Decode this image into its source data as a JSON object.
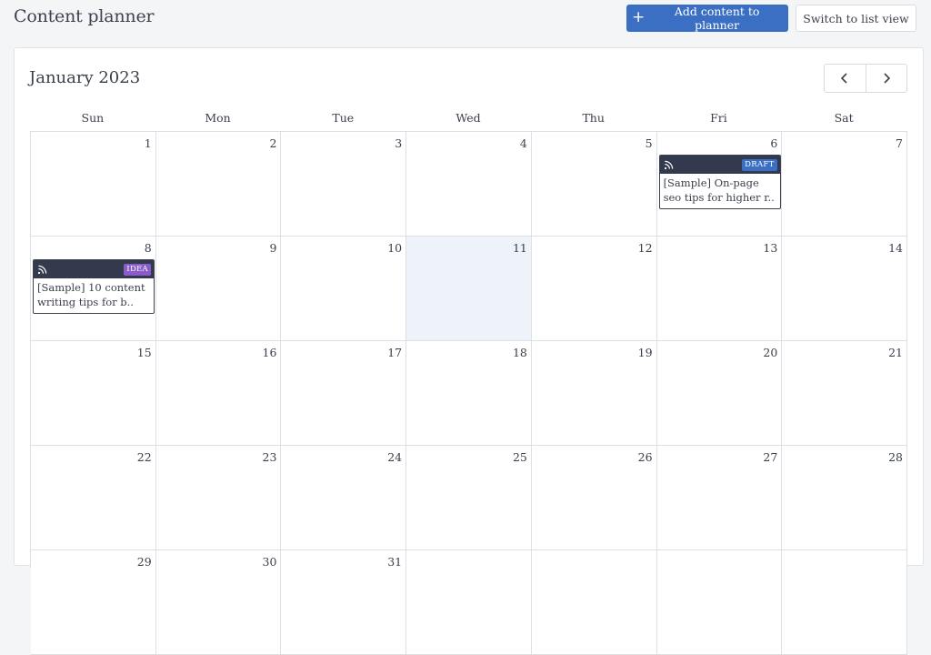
{
  "header": {
    "title": "Content planner",
    "add_label": "Add content to planner",
    "switch_label": "Switch to list view"
  },
  "calendar": {
    "month_label": "January 2023",
    "weekdays": [
      "Sun",
      "Mon",
      "Tue",
      "Wed",
      "Thu",
      "Fri",
      "Sat"
    ],
    "weeks": [
      [
        "1",
        "2",
        "3",
        "4",
        "5",
        "6",
        "7"
      ],
      [
        "8",
        "9",
        "10",
        "11",
        "12",
        "13",
        "14"
      ],
      [
        "15",
        "16",
        "17",
        "18",
        "19",
        "20",
        "21"
      ],
      [
        "22",
        "23",
        "24",
        "25",
        "26",
        "27",
        "28"
      ],
      [
        "29",
        "30",
        "31",
        "",
        "",
        "",
        ""
      ]
    ],
    "today": "11",
    "events": {
      "e1": {
        "status": "DRAFT",
        "text": "[Sample] On-page seo tips for higher r.."
      },
      "e2": {
        "status": "IDEA",
        "text": "[Sample] 10 content writing tips for b.."
      }
    }
  },
  "colors": {
    "primary": "#3a6fc4",
    "event_header": "#343a4d",
    "draft_badge": "#3a6fc4",
    "idea_badge": "#8a5cc9",
    "today_bg": "#eef3fa"
  },
  "icons": {
    "add": "plus-icon",
    "prev": "chevron-left-icon",
    "next": "chevron-right-icon",
    "event": "rss-icon"
  }
}
